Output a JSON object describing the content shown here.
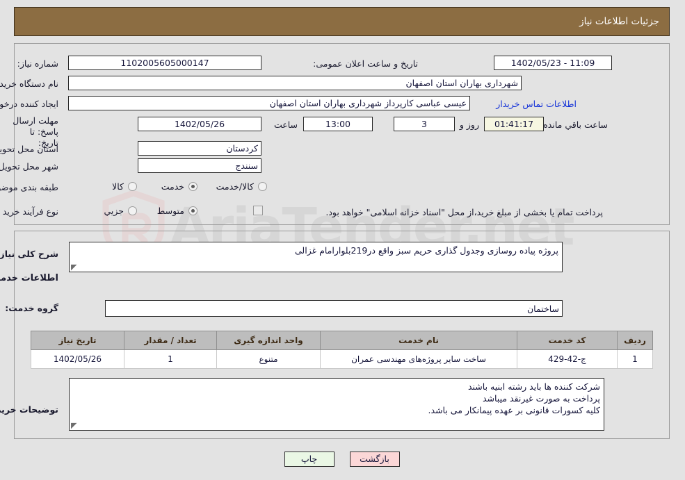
{
  "header": {
    "title": "جزئیات اطلاعات نیاز"
  },
  "top": {
    "need_number_label": "شماره نیاز:",
    "need_number_value": "1102005605000147",
    "announce_label": "تاریخ و ساعت اعلان عمومی:",
    "announce_value": "11:09 - 1402/05/23",
    "buyer_org_label": "نام دستگاه خریدار:",
    "buyer_org_value": "شهرداری بهاران استان اصفهان",
    "creator_label": "ایجاد کننده درخواست:",
    "creator_value": "عیسی عباسی کارپرداز شهرداری بهاران استان اصفهان",
    "contact_link": "اطلاعات تماس خریدار",
    "deadline_label": "مهلت ارسال پاسخ: تا تاریخ:",
    "deadline_date": "1402/05/26",
    "hour_label": "ساعت",
    "hour_value": "13:00",
    "days_value": "3",
    "days_label": "روز و",
    "countdown_value": "01:41:17",
    "countdown_label": "ساعت باقي مانده",
    "province_label": "استان محل تحویل:",
    "province_value": "کردستان",
    "city_label": "شهر محل تحویل:",
    "city_value": "سنندج",
    "category_label": "طبقه بندی موضوعی:",
    "category_options": [
      "کالا",
      "خدمت",
      "کالا/خدمت"
    ],
    "category_selected": "خدمت",
    "purchase_label": "نوع فرآیند خرید :",
    "purchase_options": [
      "جزیي",
      "متوسط"
    ],
    "purchase_selected": "متوسط",
    "treasury_checkbox_label": "پرداخت تمام یا بخشی از مبلغ خرید،از محل \"اسناد خزانه اسلامی\" خواهد بود.",
    "treasury_checked": false
  },
  "bottom": {
    "summary_label": "شرح کلی نیاز:",
    "summary_value": "پروژه پیاده روسازی وجدول گذاری حریم سبز واقع در219بلوارامام غزالی",
    "services_info_title": "اطلاعات خدمات مورد نیاز",
    "service_group_label": "گروه خدمت:",
    "service_group_value": "ساختمان",
    "table": {
      "columns": [
        "ردیف",
        "کد خدمت",
        "نام خدمت",
        "واحد اندازه گیری",
        "تعداد / مقدار",
        "تاریخ نیاز"
      ],
      "rows": [
        {
          "row": "1",
          "code": "ج-42-429",
          "name": "ساخت سایر پروژه‌های مهندسی عمران",
          "unit": "متنوع",
          "qty": "1",
          "date": "1402/05/26"
        }
      ]
    },
    "notes_label": "توضیحات خریدار:",
    "notes_lines": [
      "شرکت کننده ها باید رشته  ابنیه باشند",
      "پرداخت به صورت غیرنقد  میباشد",
      "کلیه کسورات قانونی بر عهده پیمانکار می باشد."
    ]
  },
  "footer": {
    "print_label": "چاپ",
    "back_label": "بازگشت"
  },
  "watermark": {
    "text": "AriaTender.net"
  },
  "colors": {
    "header_brown": "#8C6D42",
    "page_bg": "#e3e3e3",
    "link_blue": "#1533d8",
    "back_btn_bg": "#fbd7d7",
    "print_btn_bg": "#eaf7e5",
    "table_header_bg": "#bdbdbd",
    "countdown_bg": "#f7f7e2"
  }
}
